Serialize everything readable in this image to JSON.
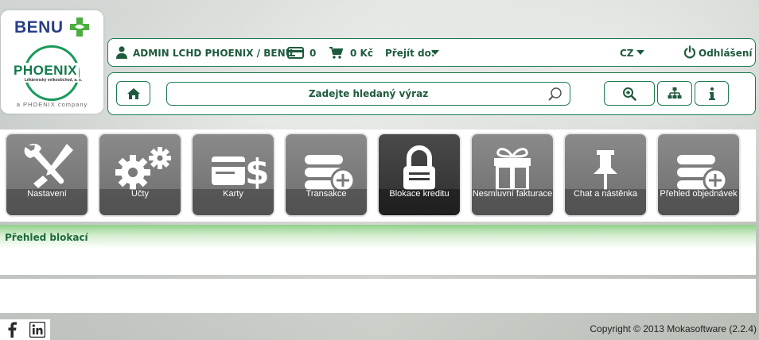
{
  "logo": {
    "benu": "BENU",
    "phoenix": "PHOENIX",
    "phoenix_sub": "Lékárenský velkoobchod, a. s.",
    "company": "a PHOENIX company"
  },
  "topbar": {
    "user": "ADMIN LCHD PHOENIX / BENU",
    "cards_count": "0",
    "cart_total": "0 Kč",
    "goto_label": "Přejít do:",
    "language": "CZ",
    "logout_label": "Odhlášení"
  },
  "search": {
    "placeholder": "Zadejte hledaný výraz"
  },
  "tiles": [
    {
      "label": "Nastavení",
      "icon": "tools-icon"
    },
    {
      "label": "Účty",
      "icon": "gears-icon"
    },
    {
      "label": "Karty",
      "icon": "credit-card-dollar-icon"
    },
    {
      "label": "Transakce",
      "icon": "server-add-icon"
    },
    {
      "label": "Blokace kreditu",
      "icon": "lock-icon"
    },
    {
      "label": "Nesmluvní fakturace",
      "icon": "gift-icon"
    },
    {
      "label": "Chat a nástěnka",
      "icon": "pin-icon"
    },
    {
      "label": "Přehled objednávek",
      "icon": "server-add-icon"
    }
  ],
  "section": {
    "title": "Přehled blokací"
  },
  "footer": {
    "copyright": "Copyright © 2013 Mokasoftware (2.2.4)"
  },
  "colors": {
    "accent": "#1d7a4e",
    "text": "#1e5a3c",
    "tile": "#7a7a7a",
    "tile_active": "#3a3a3a"
  }
}
